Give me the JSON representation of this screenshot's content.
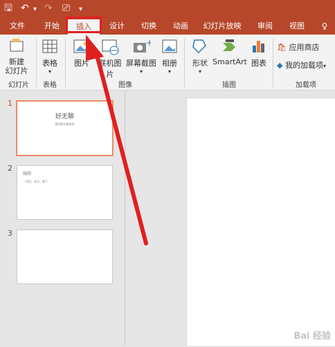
{
  "qat": {
    "save_icon": "save-icon",
    "undo_icon": "undo-icon",
    "redo_icon": "redo-icon",
    "customize_icon": "customize-qat-icon"
  },
  "tabs": [
    "文件",
    "开始",
    "插入",
    "设计",
    "切换",
    "动画",
    "幻灯片放映",
    "审阅",
    "视图"
  ],
  "active_tab": "插入",
  "ribbon": {
    "buttons": {
      "new_slide": "新建\n幻灯片",
      "table": "表格",
      "picture": "图片",
      "online_picture": "联机图片",
      "screenshot": "屏幕截图",
      "album": "相册",
      "shapes": "形状",
      "smartart": "SmartArt",
      "chart": "图表",
      "store": "应用商店",
      "my_addins": "我的加载项"
    },
    "groups": {
      "slides": "幻灯片",
      "tables": "表格",
      "images": "图像",
      "illustrations": "插图",
      "addins": "加载项"
    }
  },
  "slides": {
    "numbers": [
      "1",
      "2",
      "3"
    ],
    "slide1_title": "好无聊",
    "slide1_subtitle": "赞同是在哪里呢",
    "slide2_title": "玩的",
    "slide2_body": "一项目，有点，懂了"
  },
  "watermark": "Bai 经验"
}
